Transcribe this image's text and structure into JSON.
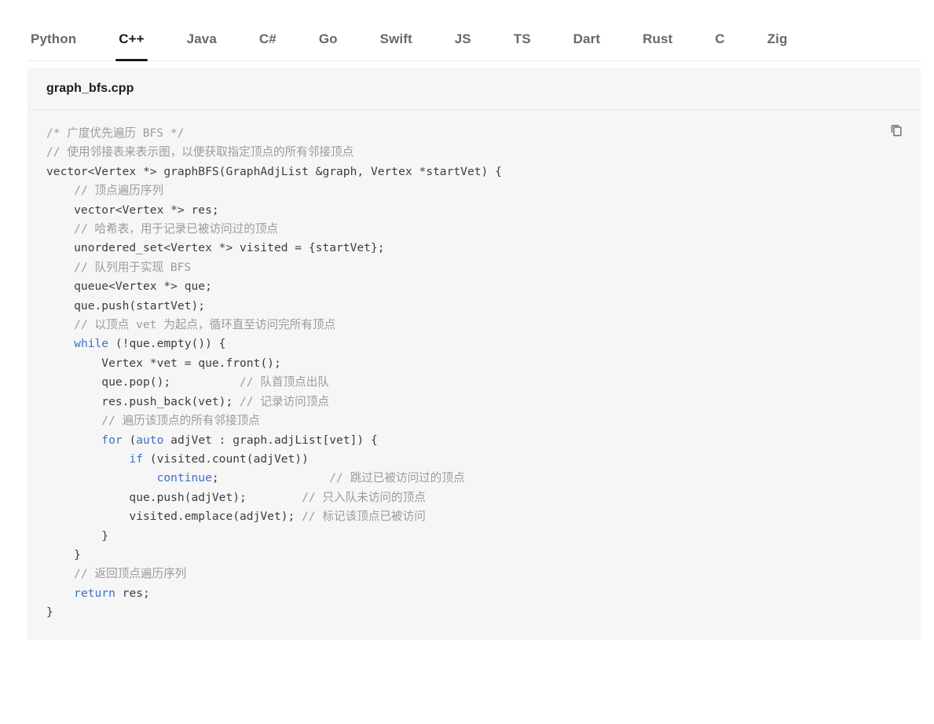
{
  "tabs": [
    {
      "label": "Python",
      "active": false
    },
    {
      "label": "C++",
      "active": true
    },
    {
      "label": "Java",
      "active": false
    },
    {
      "label": "C#",
      "active": false
    },
    {
      "label": "Go",
      "active": false
    },
    {
      "label": "Swift",
      "active": false
    },
    {
      "label": "JS",
      "active": false
    },
    {
      "label": "TS",
      "active": false
    },
    {
      "label": "Dart",
      "active": false
    },
    {
      "label": "Rust",
      "active": false
    },
    {
      "label": "C",
      "active": false
    },
    {
      "label": "Zig",
      "active": false
    }
  ],
  "code_block": {
    "filename": "graph_bfs.cpp",
    "language": "cpp",
    "copy_icon": "copy-icon",
    "colors": {
      "background": "#f6f6f7",
      "text": "#3c3c43",
      "comment": "#9b9b9f",
      "keyword": "#3f6fc9",
      "accent": "#1b1b1f"
    },
    "lines": [
      [
        {
          "t": "/* 广度优先遍历 BFS */",
          "c": "cm"
        }
      ],
      [
        {
          "t": "// 使用邻接表来表示图，以便获取指定顶点的所有邻接顶点",
          "c": "cm"
        }
      ],
      [
        {
          "t": "vector<Vertex *> graphBFS(GraphAdjList &graph, Vertex *startVet) {",
          "c": "pl"
        }
      ],
      [
        {
          "t": "    ",
          "c": "pl"
        },
        {
          "t": "// 顶点遍历序列",
          "c": "cm"
        }
      ],
      [
        {
          "t": "    vector<Vertex *> res;",
          "c": "pl"
        }
      ],
      [
        {
          "t": "    ",
          "c": "pl"
        },
        {
          "t": "// 哈希表，用于记录已被访问过的顶点",
          "c": "cm"
        }
      ],
      [
        {
          "t": "    unordered_set<Vertex *> visited = {startVet};",
          "c": "pl"
        }
      ],
      [
        {
          "t": "    ",
          "c": "pl"
        },
        {
          "t": "// 队列用于实现 BFS",
          "c": "cm"
        }
      ],
      [
        {
          "t": "    queue<Vertex *> que;",
          "c": "pl"
        }
      ],
      [
        {
          "t": "    que.push(startVet);",
          "c": "pl"
        }
      ],
      [
        {
          "t": "    ",
          "c": "pl"
        },
        {
          "t": "// 以顶点 vet 为起点，循环直至访问完所有顶点",
          "c": "cm"
        }
      ],
      [
        {
          "t": "    ",
          "c": "pl"
        },
        {
          "t": "while",
          "c": "kw"
        },
        {
          "t": " (!que.empty()) {",
          "c": "pl"
        }
      ],
      [
        {
          "t": "        Vertex *vet = que.front();",
          "c": "pl"
        }
      ],
      [
        {
          "t": "        que.pop();          ",
          "c": "pl"
        },
        {
          "t": "// 队首顶点出队",
          "c": "cm"
        }
      ],
      [
        {
          "t": "        res.push_back(vet); ",
          "c": "pl"
        },
        {
          "t": "// 记录访问顶点",
          "c": "cm"
        }
      ],
      [
        {
          "t": "        ",
          "c": "pl"
        },
        {
          "t": "// 遍历该顶点的所有邻接顶点",
          "c": "cm"
        }
      ],
      [
        {
          "t": "        ",
          "c": "pl"
        },
        {
          "t": "for",
          "c": "kw"
        },
        {
          "t": " (",
          "c": "pl"
        },
        {
          "t": "auto",
          "c": "kw"
        },
        {
          "t": " adjVet : graph.adjList[vet]) {",
          "c": "pl"
        }
      ],
      [
        {
          "t": "            ",
          "c": "pl"
        },
        {
          "t": "if",
          "c": "kw"
        },
        {
          "t": " (visited.count(adjVet))",
          "c": "pl"
        }
      ],
      [
        {
          "t": "                ",
          "c": "pl"
        },
        {
          "t": "continue",
          "c": "kw"
        },
        {
          "t": ";                ",
          "c": "pl"
        },
        {
          "t": "// 跳过已被访问过的顶点",
          "c": "cm"
        }
      ],
      [
        {
          "t": "            que.push(adjVet);        ",
          "c": "pl"
        },
        {
          "t": "// 只入队未访问的顶点",
          "c": "cm"
        }
      ],
      [
        {
          "t": "            visited.emplace(adjVet); ",
          "c": "pl"
        },
        {
          "t": "// 标记该顶点已被访问",
          "c": "cm"
        }
      ],
      [
        {
          "t": "        }",
          "c": "pl"
        }
      ],
      [
        {
          "t": "    }",
          "c": "pl"
        }
      ],
      [
        {
          "t": "    ",
          "c": "pl"
        },
        {
          "t": "// 返回顶点遍历序列",
          "c": "cm"
        }
      ],
      [
        {
          "t": "    ",
          "c": "pl"
        },
        {
          "t": "return",
          "c": "kw"
        },
        {
          "t": " res;",
          "c": "pl"
        }
      ],
      [
        {
          "t": "}",
          "c": "pl"
        }
      ]
    ]
  }
}
